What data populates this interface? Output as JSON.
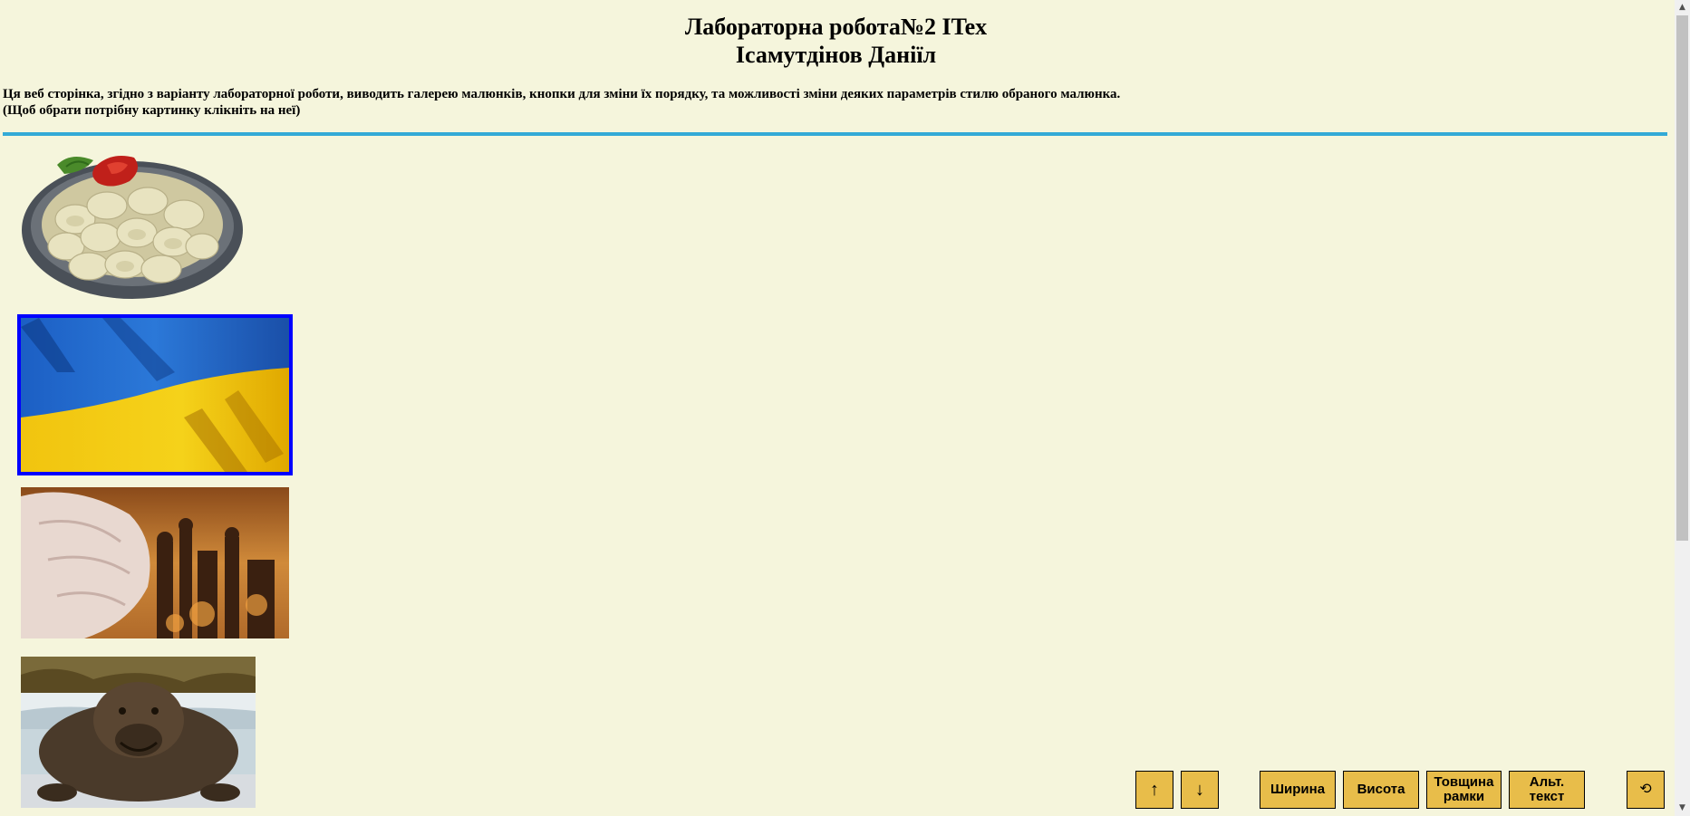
{
  "header": {
    "title_line1": "Лабораторна робота№2 ITex",
    "title_line2": "Ісамутдінов Даніїл"
  },
  "description": {
    "line1": "Ця веб сторінка, згідно з варіанту лабораторної роботи, виводить галерею малюнків, кнопки для зміни їх порядку, та можливості зміни деяких параметрів стилю обраного малюнка.",
    "line2": "(Щоб обрати потрібну картинку клікніть на неї)"
  },
  "gallery": {
    "images": [
      {
        "subject": "dumplings-plate",
        "selected": false
      },
      {
        "subject": "ukrainian-flag",
        "selected": true
      },
      {
        "subject": "fist-over-burning-city",
        "selected": false
      },
      {
        "subject": "elephant-seal",
        "selected": false
      }
    ],
    "selected_border_color": "#0000ff"
  },
  "controls": {
    "up_label": "↑",
    "down_label": "↓",
    "width_label": "Ширина",
    "height_label": "Висота",
    "border_label_line1": "Товщина",
    "border_label_line2": "рамки",
    "alt_label_line1": "Альт.",
    "alt_label_line2": "текст",
    "reset_label": "⟲",
    "button_color": "#e8bd4a"
  },
  "colors": {
    "background": "#f5f5dc",
    "divider": "#33aad6"
  }
}
